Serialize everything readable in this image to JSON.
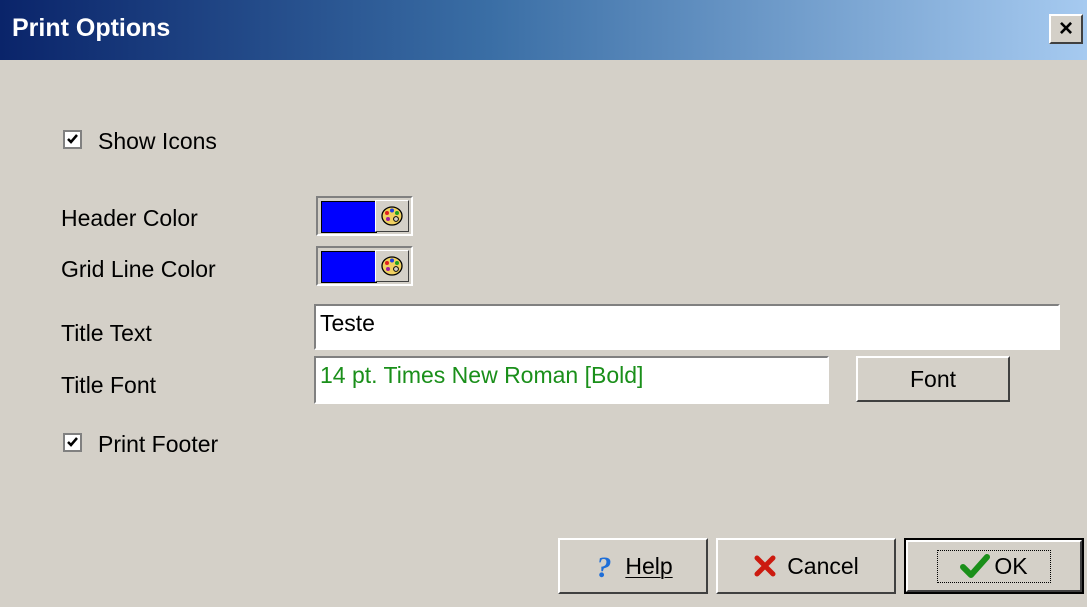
{
  "window": {
    "title": "Print Options",
    "close_label": "×"
  },
  "options": {
    "show_icons": {
      "label": "Show Icons",
      "checked": true
    },
    "header_color": {
      "label": "Header Color",
      "value": "#0000ff"
    },
    "grid_line_color": {
      "label": "Grid Line Color",
      "value": "#0000ff"
    },
    "title_text": {
      "label": "Title Text",
      "value": "Teste"
    },
    "title_font": {
      "label": "Title Font",
      "value": "14 pt. Times New Roman  [Bold]",
      "button_label": "Font"
    },
    "print_footer": {
      "label": "Print Footer",
      "checked": true
    }
  },
  "buttons": {
    "help": {
      "label": "Help",
      "mnemonic": "H"
    },
    "cancel": {
      "label": "Cancel"
    },
    "ok": {
      "label": "OK"
    }
  },
  "colors": {
    "title_font_text": "#1a8f1a",
    "help_icon": "#1e6ed8",
    "cancel_icon": "#cc1a0f",
    "ok_icon": "#1a8f1a"
  },
  "icons": {
    "palette": "palette-icon",
    "help": "question-mark-icon",
    "cancel": "red-x-icon",
    "ok": "green-checkmark-icon"
  }
}
